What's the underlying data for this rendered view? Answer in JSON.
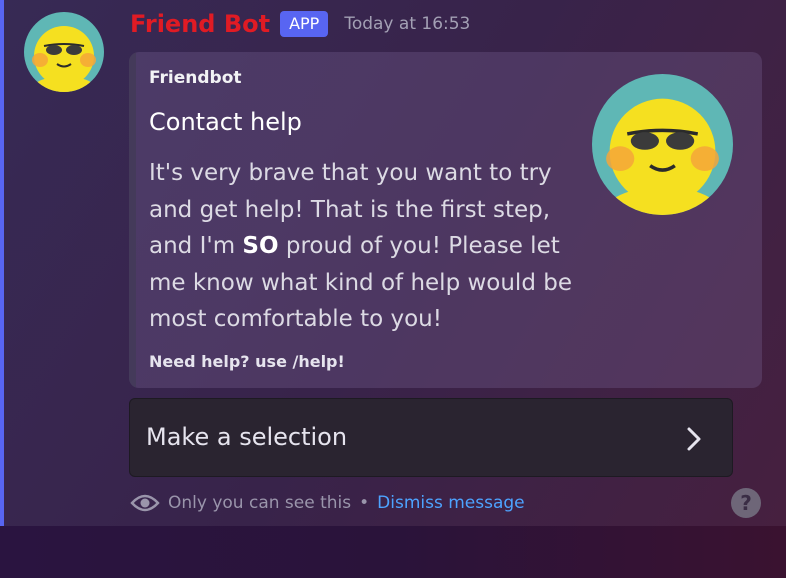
{
  "message": {
    "author": "Friend Bot",
    "badge": "APP",
    "timestamp": "Today at 16:53",
    "avatar_icon": "sunglasses-smiley-icon"
  },
  "embed": {
    "author": "Friendbot",
    "title": "Contact help",
    "description_part1": "It's very brave that you want to try and get help! That is the first step, and I'm ",
    "description_bold": "SO",
    "description_part2": " proud of you! Please let me know what kind of help would be most comfortable to you!",
    "footer": "Need help? use /help!",
    "thumbnail_icon": "sunglasses-smiley-icon"
  },
  "select_menu": {
    "placeholder": "Make a selection",
    "chevron_icon": "chevron-right-icon"
  },
  "ephemeral": {
    "icon": "eye-icon",
    "text": "Only you can see this",
    "separator": "•",
    "dismiss_label": "Dismiss message"
  },
  "help_icon": "?",
  "colors": {
    "author_name": "#e01b24",
    "app_badge": "#5865f2",
    "link": "#4da3ff",
    "accent_bar": "#5865f2"
  }
}
